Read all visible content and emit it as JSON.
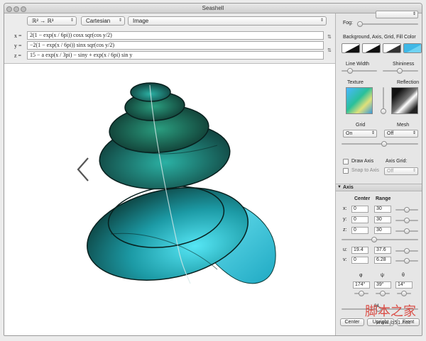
{
  "window": {
    "title": "Seashell"
  },
  "toolbar": {
    "mapping": "ℝ² → ℝ³",
    "coords": "Cartesian",
    "view": "Image"
  },
  "equations": [
    {
      "label": "x =",
      "value": "2(1 − exp(x / 6pi)) cosx sqr(cos y/2)"
    },
    {
      "label": "y =",
      "value": "−2(1 − exp(x / 6pi)) sinx sqr(cos y/2)"
    },
    {
      "label": "z =",
      "value": "15 − a exp(x / 3pi) − siny + exp(x / 6pi) sin y"
    }
  ],
  "sidebar": {
    "fog_label": "Fog:",
    "colors_label": "Background, Axis, Grid, Fill Color",
    "line_width_label": "Line Width",
    "shininess_label": "Shininess",
    "texture_label": "Texture",
    "reflection_label": "Reflection",
    "grid_label": "Grid",
    "mesh_label": "Mesh",
    "grid_value": "On",
    "mesh_value": "Off",
    "draw_axis_label": "Draw Axis",
    "snap_axis_label": "Snap to Axis",
    "axis_grid_label": "Axis Grid:",
    "axis_grid_value": "Off",
    "axis_section": "Axis",
    "center_label": "Center",
    "range_label": "Range",
    "axes": [
      {
        "label": "x:",
        "center": "0",
        "range": "30"
      },
      {
        "label": "y:",
        "center": "0",
        "range": "30"
      },
      {
        "label": "z:",
        "center": "0",
        "range": "30"
      }
    ],
    "params": [
      {
        "label": "u:",
        "min": "19.4",
        "max": "37.6"
      },
      {
        "label": "v:",
        "min": "0",
        "max": "6.28"
      }
    ],
    "angle_labels": [
      "φ",
      "ψ",
      "θ"
    ],
    "angles": [
      "174°",
      "39°",
      "14°"
    ],
    "zoom_value": "84",
    "buttons": {
      "center": "Center",
      "upright": "Upright",
      "front": "Front"
    }
  },
  "watermark": {
    "text": "脚本之家",
    "url": "www.jb51.net"
  },
  "colors": {
    "shell_dark": "#0d2f2c",
    "shell_mid": "#1a8a80",
    "shell_light": "#3fd6e6",
    "accent_red": "#d9342b"
  }
}
